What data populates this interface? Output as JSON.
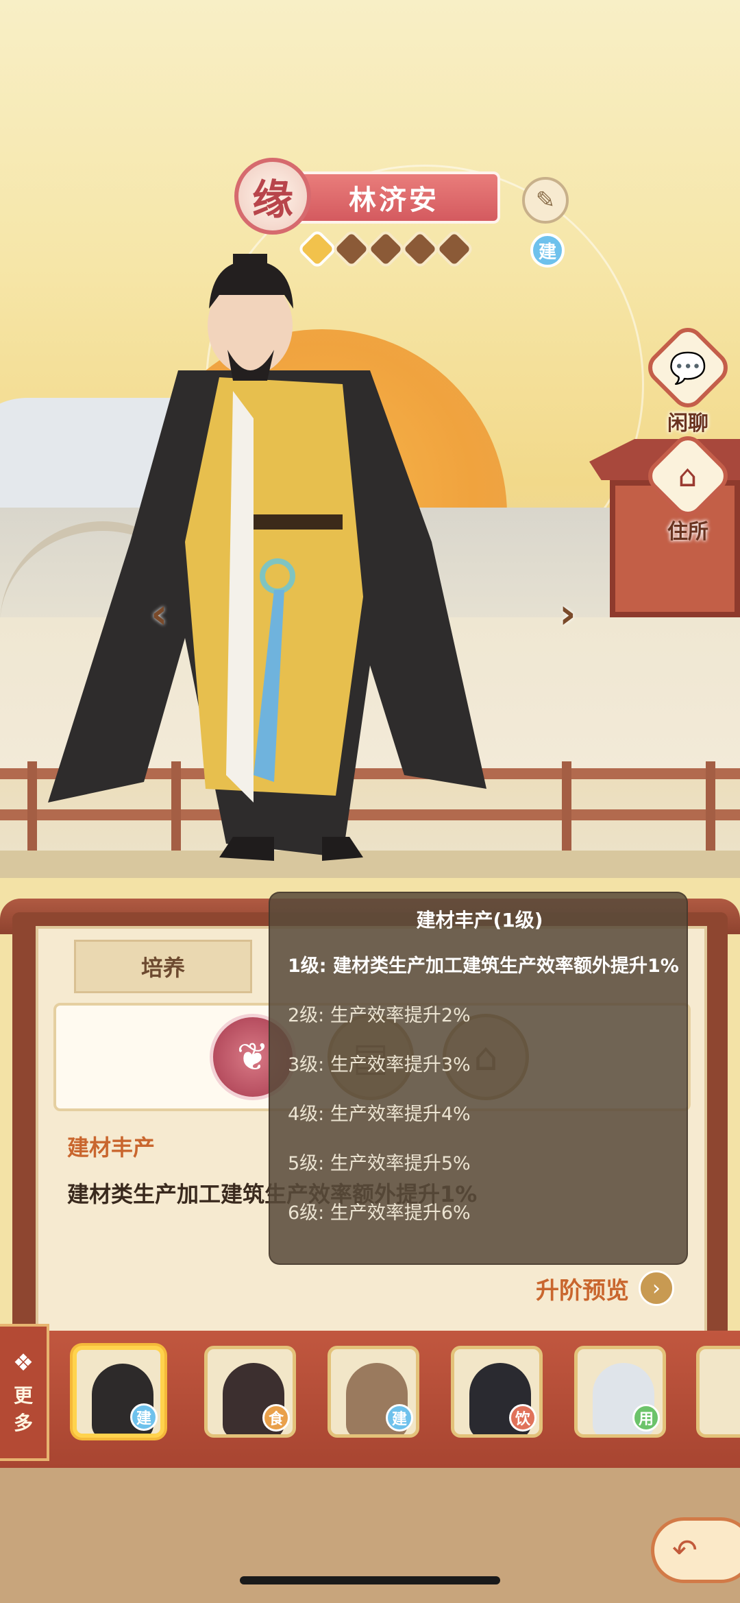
{
  "header": {
    "affinity_badge": "缘",
    "character_name": "林济安",
    "stars_total": 5,
    "stars_filled": 1,
    "type_badge": "建"
  },
  "side_buttons": [
    {
      "label": "闲聊",
      "icon": "chat-icon"
    },
    {
      "label": "住所",
      "icon": "house-icon"
    }
  ],
  "panel": {
    "tabs": [
      "培养"
    ],
    "skill_title": "建材丰产",
    "skill_desc": "建材类生产加工建筑生产效率额外提升1%",
    "preview_label": "升阶预览"
  },
  "tooltip": {
    "title": "建材丰产(1级)",
    "lines": [
      "1级: 建材类生产加工建筑生产效率额外提升1%",
      "2级: 生产效率提升2%",
      "3级: 生产效率提升3%",
      "4级: 生产效率提升4%",
      "5级: 生产效率提升5%",
      "6级: 生产效率提升6%"
    ]
  },
  "more_button": {
    "label_top": "更",
    "label_bottom": "多"
  },
  "roster": [
    {
      "tag": "建",
      "tag_color": "#6ec1ec",
      "selected": true
    },
    {
      "tag": "食",
      "tag_color": "#e9a04a",
      "selected": false
    },
    {
      "tag": "建",
      "tag_color": "#6ec1ec",
      "selected": false
    },
    {
      "tag": "饮",
      "tag_color": "#e0725a",
      "selected": false
    },
    {
      "tag": "用",
      "tag_color": "#6cc36a",
      "selected": false
    }
  ],
  "colors": {
    "accent_red": "#d45a5f",
    "panel_brown": "#8e4630",
    "skill_orange": "#c9662e"
  }
}
